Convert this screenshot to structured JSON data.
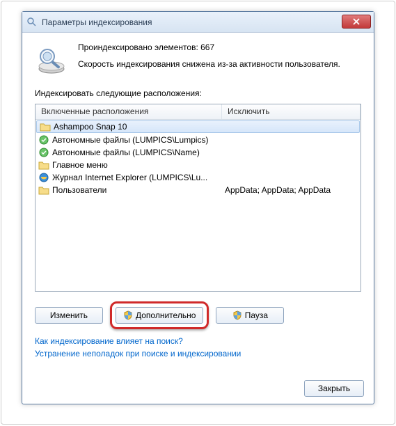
{
  "window": {
    "title": "Параметры индексирования"
  },
  "header": {
    "indexed_line": "Проиндексировано элементов: 667",
    "speed_line": "Скорость индексирования снижена из-за активности пользователя."
  },
  "locations_label": "Индексировать следующие расположения:",
  "columns": {
    "included": "Включенные расположения",
    "exclude": "Исключить"
  },
  "rows": [
    {
      "icon": "folder",
      "name": "Ashampoo Snap 10",
      "exclude": "",
      "selected": true
    },
    {
      "icon": "offline",
      "name": "Автономные файлы (LUMPICS\\Lumpics)",
      "exclude": "",
      "selected": false
    },
    {
      "icon": "offline",
      "name": "Автономные файлы (LUMPICS\\Name)",
      "exclude": "",
      "selected": false
    },
    {
      "icon": "folder",
      "name": "Главное меню",
      "exclude": "",
      "selected": false
    },
    {
      "icon": "ie",
      "name": "Журнал Internet Explorer (LUMPICS\\Lu...",
      "exclude": "",
      "selected": false
    },
    {
      "icon": "folder",
      "name": "Пользователи",
      "exclude": "AppData; AppData; AppData",
      "selected": false
    }
  ],
  "buttons": {
    "modify": "Изменить",
    "advanced": "Дополнительно",
    "pause": "Пауза",
    "close": "Закрыть"
  },
  "links": {
    "how_affects": "Как индексирование влияет на поиск?",
    "troubleshoot": "Устранение неполадок при поиске и индексировании"
  }
}
